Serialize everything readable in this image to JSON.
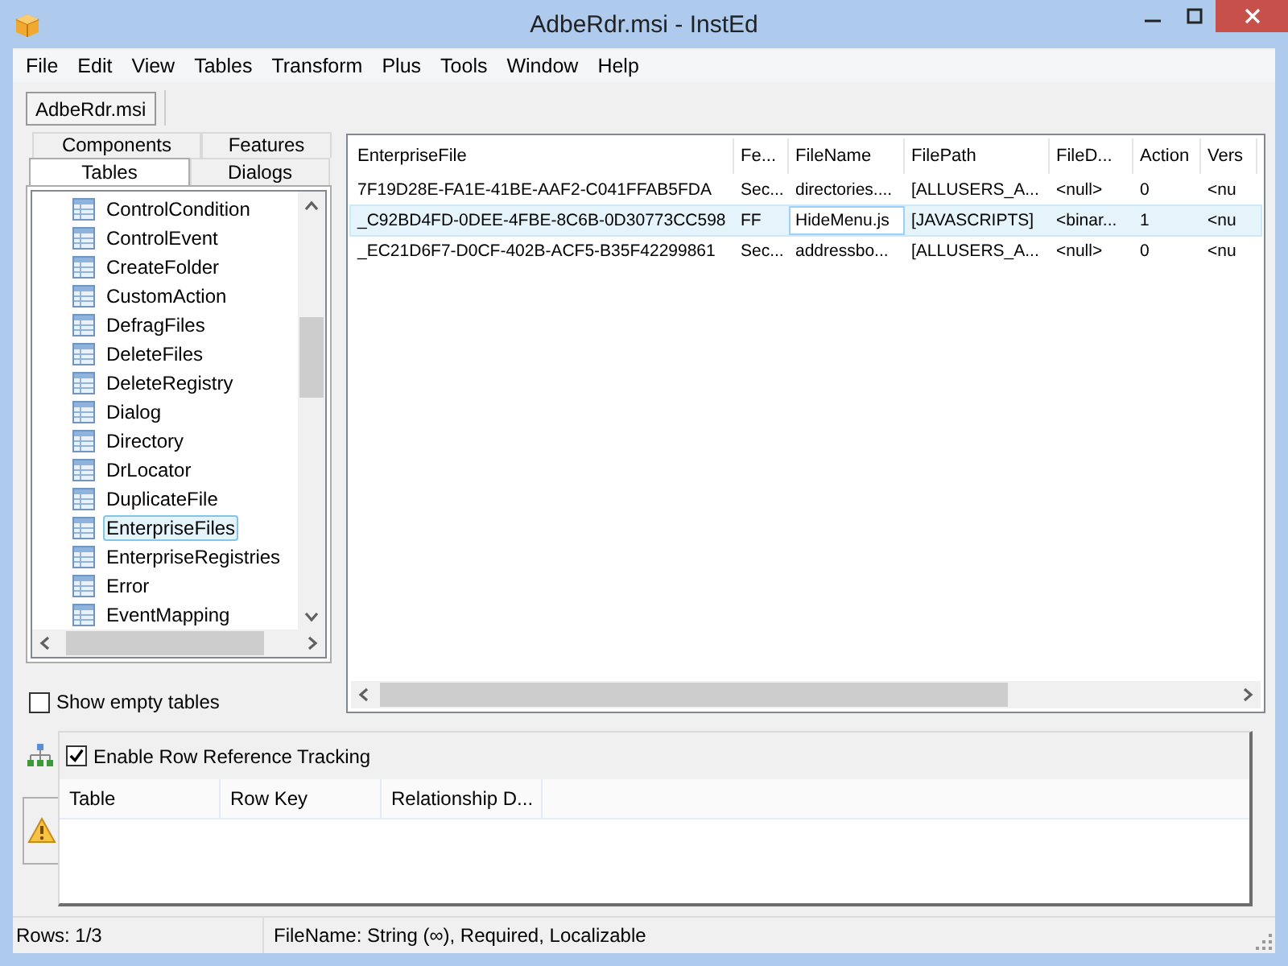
{
  "window": {
    "title": "AdbeRdr.msi - InstEd"
  },
  "menu": [
    "File",
    "Edit",
    "View",
    "Tables",
    "Transform",
    "Plus",
    "Tools",
    "Window",
    "Help"
  ],
  "documents": [
    {
      "label": "AdbeRdr.msi",
      "selected": true
    }
  ],
  "side_tab_rows": [
    [
      {
        "label": "Components",
        "selected": false
      },
      {
        "label": "Features",
        "selected": false
      }
    ],
    [
      {
        "label": "Tables",
        "selected": true
      },
      {
        "label": "Dialogs",
        "selected": false
      }
    ]
  ],
  "tables": [
    {
      "label": "ControlCondition",
      "selected": false
    },
    {
      "label": "ControlEvent",
      "selected": false
    },
    {
      "label": "CreateFolder",
      "selected": false
    },
    {
      "label": "CustomAction",
      "selected": false
    },
    {
      "label": "DefragFiles",
      "selected": false
    },
    {
      "label": "DeleteFiles",
      "selected": false
    },
    {
      "label": "DeleteRegistry",
      "selected": false
    },
    {
      "label": "Dialog",
      "selected": false
    },
    {
      "label": "Directory",
      "selected": false
    },
    {
      "label": "DrLocator",
      "selected": false
    },
    {
      "label": "DuplicateFile",
      "selected": false
    },
    {
      "label": "EnterpriseFiles",
      "selected": true
    },
    {
      "label": "EnterpriseRegistries",
      "selected": false
    },
    {
      "label": "Error",
      "selected": false
    },
    {
      "label": "EventMapping",
      "selected": false
    }
  ],
  "show_empty_tables": {
    "label": "Show empty tables",
    "checked": false
  },
  "grid": {
    "columns": [
      "EnterpriseFile",
      "Fe...",
      "FileName",
      "FilePath",
      "FileD...",
      "Action",
      "Vers"
    ],
    "rows": [
      {
        "selected": false,
        "cells": [
          {
            "text": "7F19D28E-FA1E-41BE-AAF2-C041FFAB5FDA",
            "focused": false
          },
          {
            "text": "Sec...",
            "focused": false
          },
          {
            "text": "directories....",
            "focused": false
          },
          {
            "text": "[ALLUSERS_A...",
            "focused": false
          },
          {
            "text": "<null>",
            "focused": false
          },
          {
            "text": "0",
            "focused": false
          },
          {
            "text": "<nu",
            "focused": false
          }
        ]
      },
      {
        "selected": true,
        "cells": [
          {
            "text": "_C92BD4FD-0DEE-4FBE-8C6B-0D30773CC598",
            "focused": false
          },
          {
            "text": "FF",
            "focused": false
          },
          {
            "text": "HideMenu.js",
            "focused": true
          },
          {
            "text": "[JAVASCRIPTS]",
            "focused": false
          },
          {
            "text": "<binar...",
            "focused": false
          },
          {
            "text": "1",
            "focused": false
          },
          {
            "text": "<nu",
            "focused": false
          }
        ]
      },
      {
        "selected": false,
        "cells": [
          {
            "text": "_EC21D6F7-D0CF-402B-ACF5-B35F42299861",
            "focused": false
          },
          {
            "text": "Sec...",
            "focused": false
          },
          {
            "text": "addressbo...",
            "focused": false
          },
          {
            "text": "[ALLUSERS_A...",
            "focused": false
          },
          {
            "text": "<null>",
            "focused": false
          },
          {
            "text": "0",
            "focused": false
          },
          {
            "text": "<nu",
            "focused": false
          }
        ]
      }
    ]
  },
  "tracking": {
    "label": "Enable Row Reference Tracking",
    "checked": true,
    "columns": [
      "Table",
      "Row Key",
      "Relationship D..."
    ]
  },
  "status_bar": [
    "Rows: 1/3",
    "FileName: String (∞), Required, Localizable"
  ]
}
